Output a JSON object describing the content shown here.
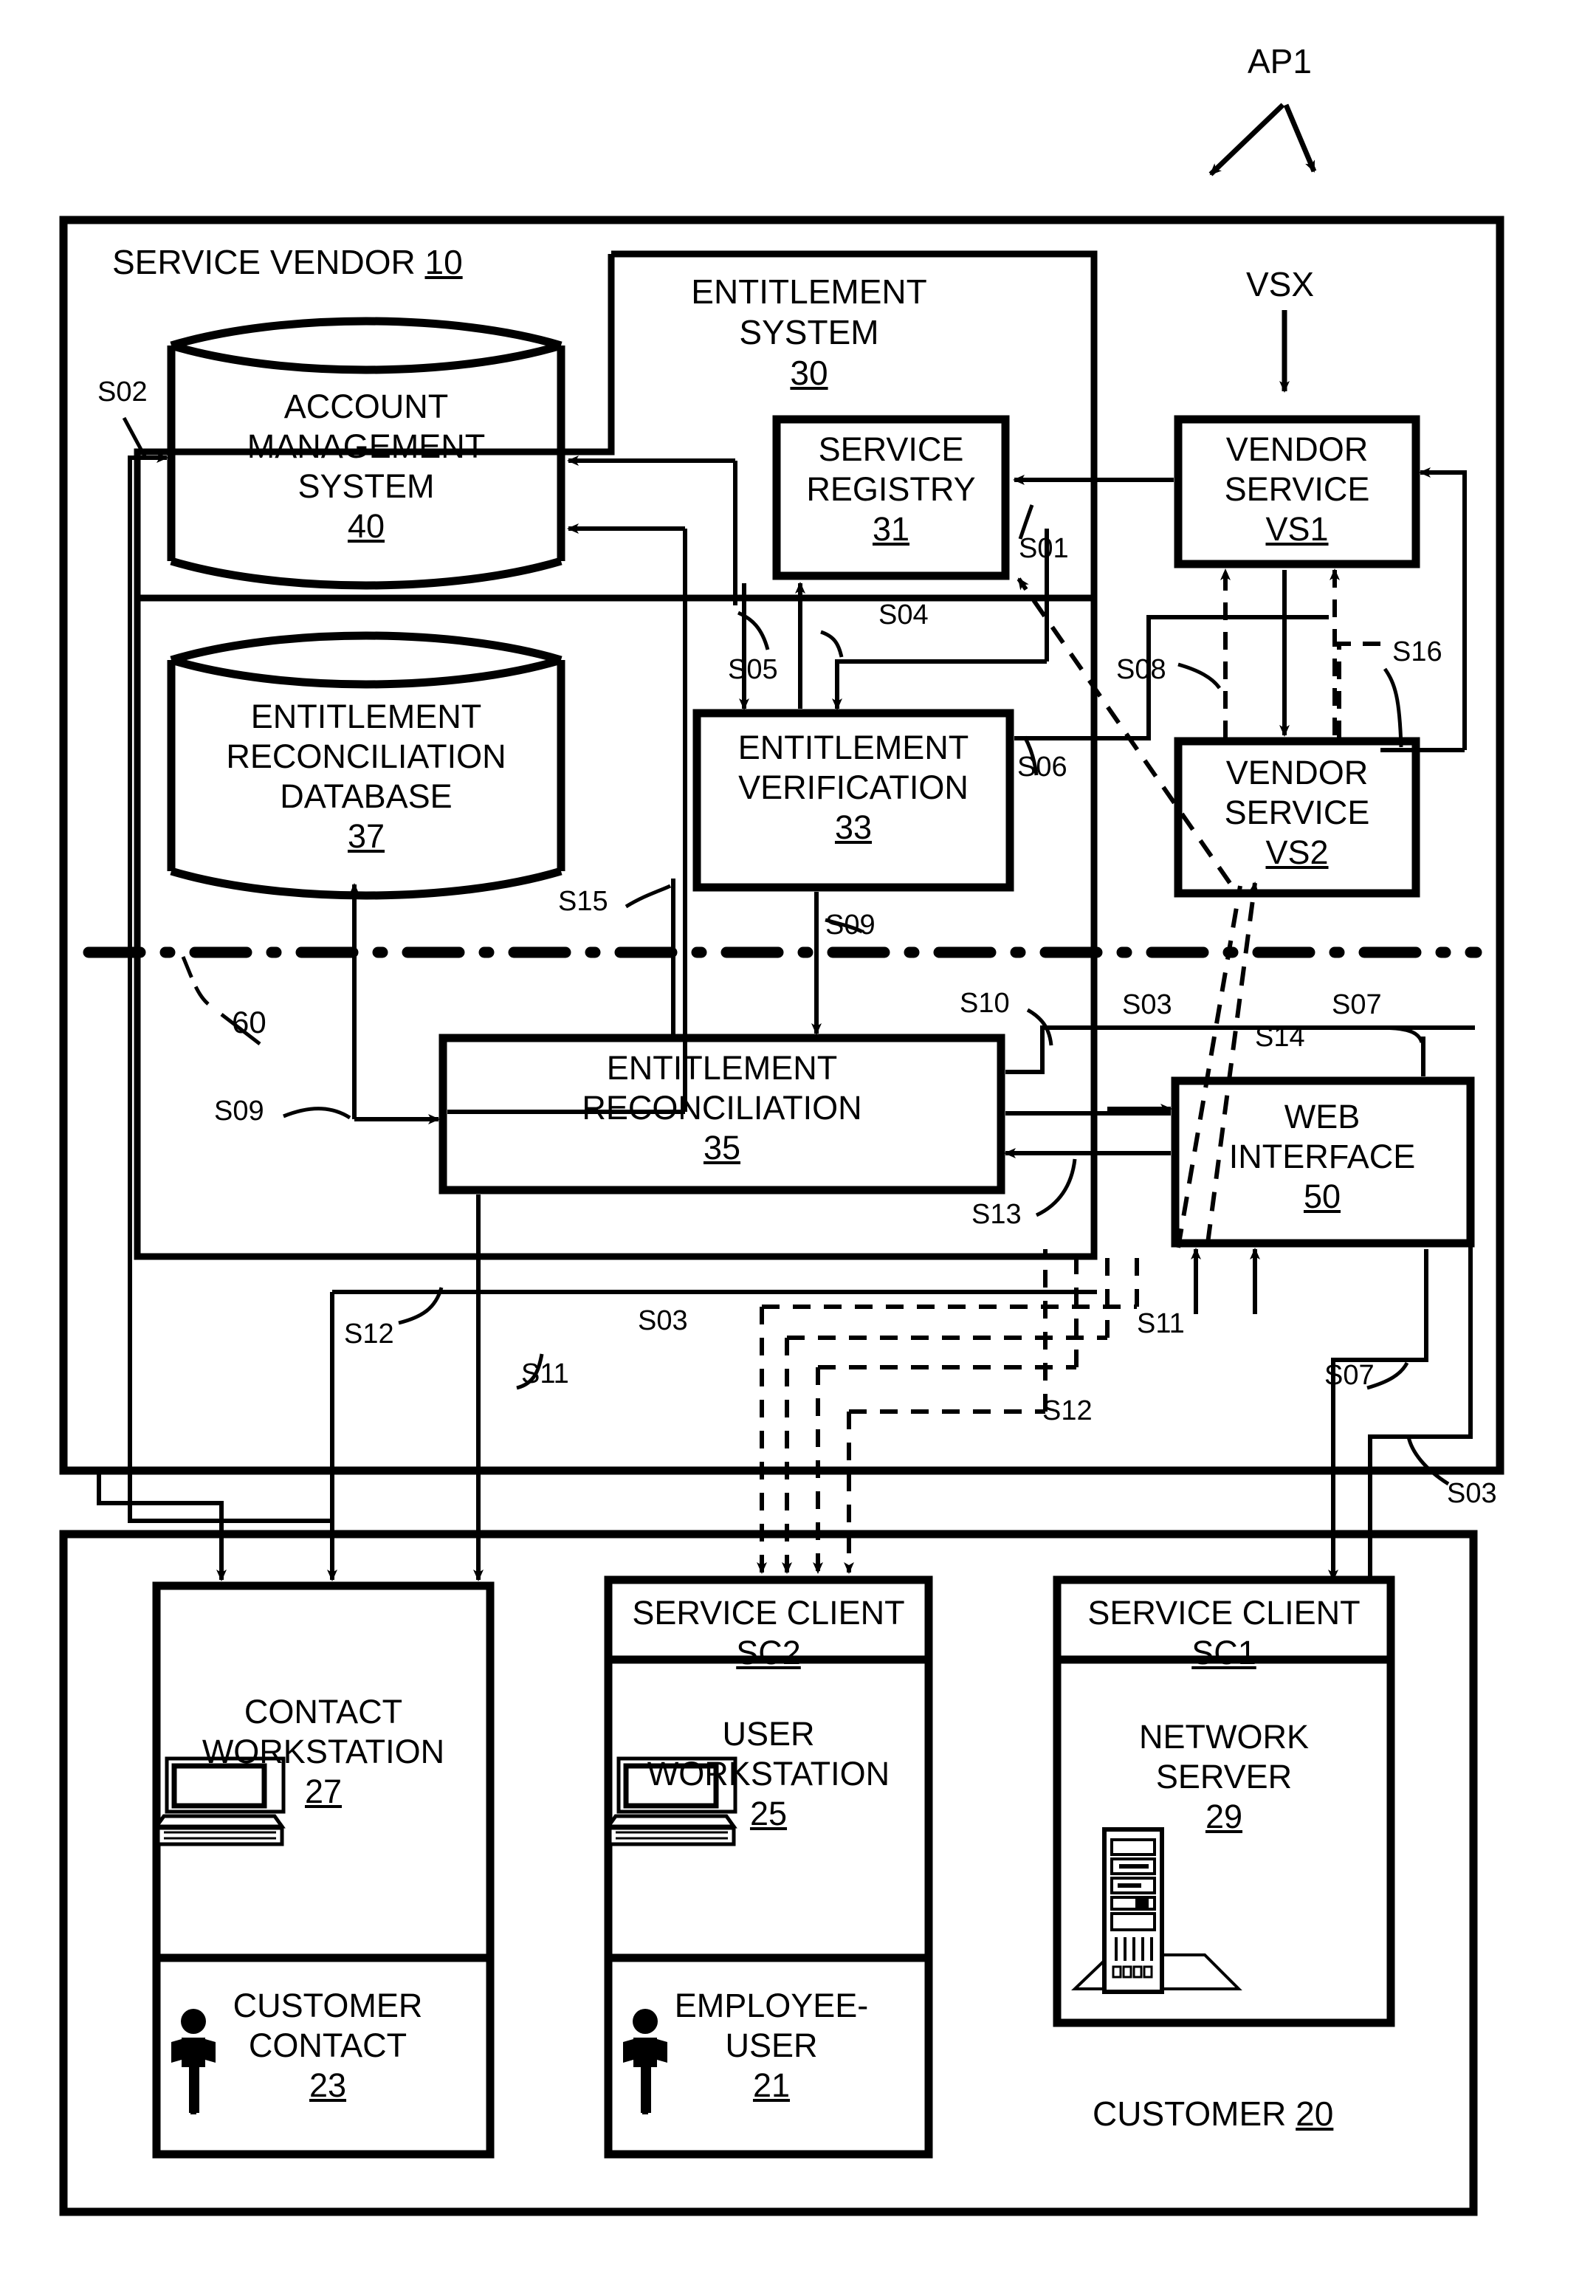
{
  "figure": {
    "callout_ap1": "AP1",
    "callout_vsx": "VSX",
    "callout_60": "60"
  },
  "containers": {
    "service_vendor": {
      "label": "SERVICE VENDOR",
      "ref": "10"
    },
    "customer": {
      "label": "CUSTOMER",
      "ref": "20"
    },
    "entitlement_system": {
      "label_line1": "ENTITLEMENT",
      "label_line2": "SYSTEM",
      "ref": "30"
    }
  },
  "blocks": {
    "account_management_system": {
      "line1": "ACCOUNT",
      "line2": "MANAGEMENT",
      "line3": "SYSTEM",
      "ref": "40",
      "shape": "cylinder"
    },
    "entitlement_reconciliation_database": {
      "line1": "ENTITLEMENT",
      "line2": "RECONCILIATION",
      "line3": "DATABASE",
      "ref": "37",
      "shape": "cylinder"
    },
    "service_registry": {
      "line1": "SERVICE",
      "line2": "REGISTRY",
      "ref": "31",
      "shape": "box"
    },
    "entitlement_verification": {
      "line1": "ENTITLEMENT",
      "line2": "VERIFICATION",
      "ref": "33",
      "shape": "box"
    },
    "entitlement_reconciliation": {
      "line1": "ENTITLEMENT",
      "line2": "RECONCILIATION",
      "ref": "35",
      "shape": "box"
    },
    "vendor_service_1": {
      "line1": "VENDOR",
      "line2": "SERVICE",
      "ref": "VS1",
      "shape": "box"
    },
    "vendor_service_2": {
      "line1": "VENDOR",
      "line2": "SERVICE",
      "ref": "VS2",
      "shape": "box"
    },
    "web_interface": {
      "line1": "WEB",
      "line2": "INTERFACE",
      "ref": "50",
      "shape": "box"
    },
    "contact_workstation": {
      "line1": "CONTACT",
      "line2": "WORKSTATION",
      "ref": "27",
      "shape": "box",
      "icon": "desktop-computer-icon"
    },
    "customer_contact": {
      "line1": "CUSTOMER",
      "line2": "CONTACT",
      "ref": "23",
      "shape": "box",
      "icon": "person-icon"
    },
    "service_client_sc2": {
      "line1": "SERVICE CLIENT",
      "ref": "SC2",
      "shape": "box"
    },
    "user_workstation": {
      "line1": "USER",
      "line2": "WORKSTATION",
      "ref": "25",
      "shape": "box",
      "icon": "desktop-computer-icon"
    },
    "employee_user": {
      "line1": "EMPLOYEE-",
      "line2": "USER",
      "ref": "21",
      "shape": "box",
      "icon": "person-icon"
    },
    "service_client_sc1": {
      "line1": "SERVICE CLIENT",
      "ref": "SC1",
      "shape": "box"
    },
    "network_server": {
      "line1": "NETWORK",
      "line2": "SERVER",
      "ref": "29",
      "shape": "box",
      "icon": "tower-server-icon"
    }
  },
  "signals": [
    {
      "id": "s01",
      "label": "S01"
    },
    {
      "id": "s02",
      "label": "S02"
    },
    {
      "id": "s03_mid",
      "label": "S03"
    },
    {
      "id": "s03_low",
      "label": "S03"
    },
    {
      "id": "s03_right",
      "label": "S03"
    },
    {
      "id": "s04",
      "label": "S04"
    },
    {
      "id": "s05",
      "label": "S05"
    },
    {
      "id": "s06",
      "label": "S06"
    },
    {
      "id": "s07_mid",
      "label": "S07"
    },
    {
      "id": "s07_low",
      "label": "S07"
    },
    {
      "id": "s08",
      "label": "S08"
    },
    {
      "id": "s09_top",
      "label": "S09"
    },
    {
      "id": "s09_left",
      "label": "S09"
    },
    {
      "id": "s10",
      "label": "S10"
    },
    {
      "id": "s11_left",
      "label": "S11"
    },
    {
      "id": "s11_right",
      "label": "S11"
    },
    {
      "id": "s12_left",
      "label": "S12"
    },
    {
      "id": "s12_right",
      "label": "S12"
    },
    {
      "id": "s13",
      "label": "S13"
    },
    {
      "id": "s14",
      "label": "S14"
    },
    {
      "id": "s15",
      "label": "S15"
    },
    {
      "id": "s16",
      "label": "S16"
    }
  ],
  "colors": {
    "stroke": "#000000",
    "background": "#ffffff"
  }
}
